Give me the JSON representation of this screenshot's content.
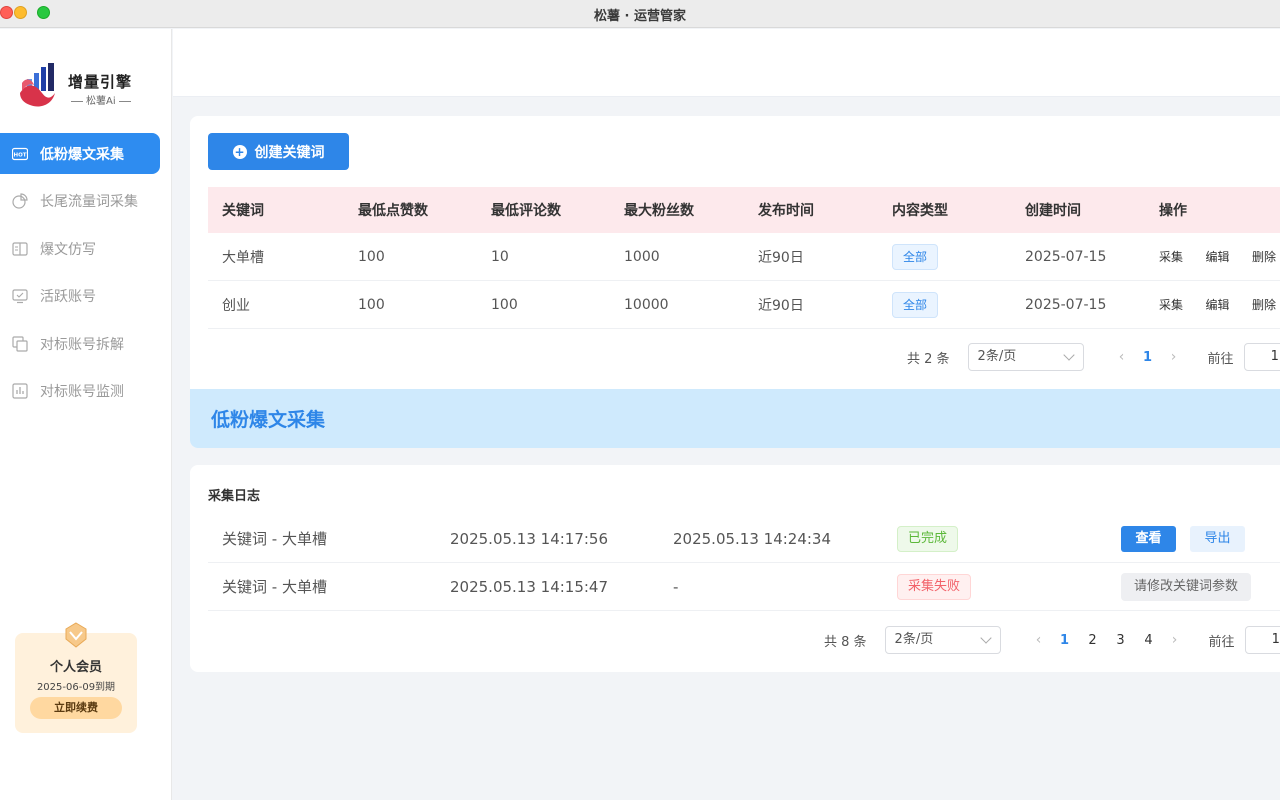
{
  "window": {
    "title": "松薯 · 运营管家"
  },
  "sidebar": {
    "logo": {
      "name": "增量引擎",
      "sub": "松薯Ai"
    },
    "items": [
      {
        "label": "低粉爆文采集",
        "icon": "hot-icon",
        "active": true
      },
      {
        "label": "长尾流量词采集",
        "icon": "pie-chart-icon",
        "active": false
      },
      {
        "label": "爆文仿写",
        "icon": "book-icon",
        "active": false
      },
      {
        "label": "活跃账号",
        "icon": "monitor-icon",
        "active": false
      },
      {
        "label": "对标账号拆解",
        "icon": "copy-icon",
        "active": false
      },
      {
        "label": "对标账号监测",
        "icon": "bar-chart-icon",
        "active": false
      }
    ],
    "member": {
      "title": "个人会员",
      "expire": "2025-06-09到期",
      "renew": "立即续费"
    }
  },
  "keywords": {
    "create_label": "创建关键词",
    "headers": [
      "关键词",
      "最低点赞数",
      "最低评论数",
      "最大粉丝数",
      "发布时间",
      "内容类型",
      "创建时间",
      "操作"
    ],
    "rows": [
      {
        "keyword": "大单槽",
        "min_likes": "100",
        "min_comments": "10",
        "max_fans": "1000",
        "publish": "近90日",
        "type": "全部",
        "created": "2025-07-15"
      },
      {
        "keyword": "创业",
        "min_likes": "100",
        "min_comments": "100",
        "max_fans": "10000",
        "publish": "近90日",
        "type": "全部",
        "created": "2025-07-15"
      }
    ],
    "ops": {
      "collect": "采集",
      "edit": "编辑",
      "delete": "删除"
    },
    "pager": {
      "total": "共 2 条",
      "size": "2条/页",
      "pages": [
        "1"
      ],
      "current": "1",
      "goto": "前往",
      "goto_value": "1"
    }
  },
  "banner": {
    "title": "低粉爆文采集"
  },
  "logs": {
    "title": "采集日志",
    "rows": [
      {
        "name": "关键词 - 大单槽",
        "start": "2025.05.13 14:17:56",
        "end": "2025.05.13 14:24:34",
        "status": "已完成",
        "status_type": "done",
        "actions": [
          "查看",
          "导出"
        ]
      },
      {
        "name": "关键词 - 大单槽",
        "start": "2025.05.13 14:15:47",
        "end": "-",
        "status": "采集失败",
        "status_type": "fail",
        "actions": [
          "请修改关键词参数"
        ]
      }
    ],
    "pager": {
      "total": "共 8 条",
      "size": "2条/页",
      "pages": [
        "1",
        "2",
        "3",
        "4"
      ],
      "current": "1",
      "goto": "前往",
      "goto_value": "1"
    }
  },
  "colors": {
    "accent": "#2e86e8",
    "success": "#5cb83a",
    "danger": "#f2626a",
    "header_bg": "#fde9ec",
    "banner_bg": "#cfeafd"
  }
}
